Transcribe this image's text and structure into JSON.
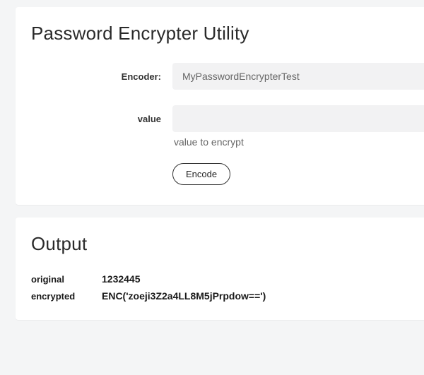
{
  "encrypter": {
    "title": "Password Encrypter Utility",
    "fields": {
      "encoder": {
        "label": "Encoder:",
        "value": "MyPasswordEncrypterTest"
      },
      "value": {
        "label": "value",
        "value": "",
        "help": "value to encrypt"
      }
    },
    "buttons": {
      "encode": "Encode"
    }
  },
  "output": {
    "title": "Output",
    "rows": {
      "original": {
        "label": "original",
        "value": "1232445"
      },
      "encrypted": {
        "label": "encrypted",
        "value": "ENC('zoeji3Z2a4LL8M5jPrpdow==')"
      }
    }
  }
}
